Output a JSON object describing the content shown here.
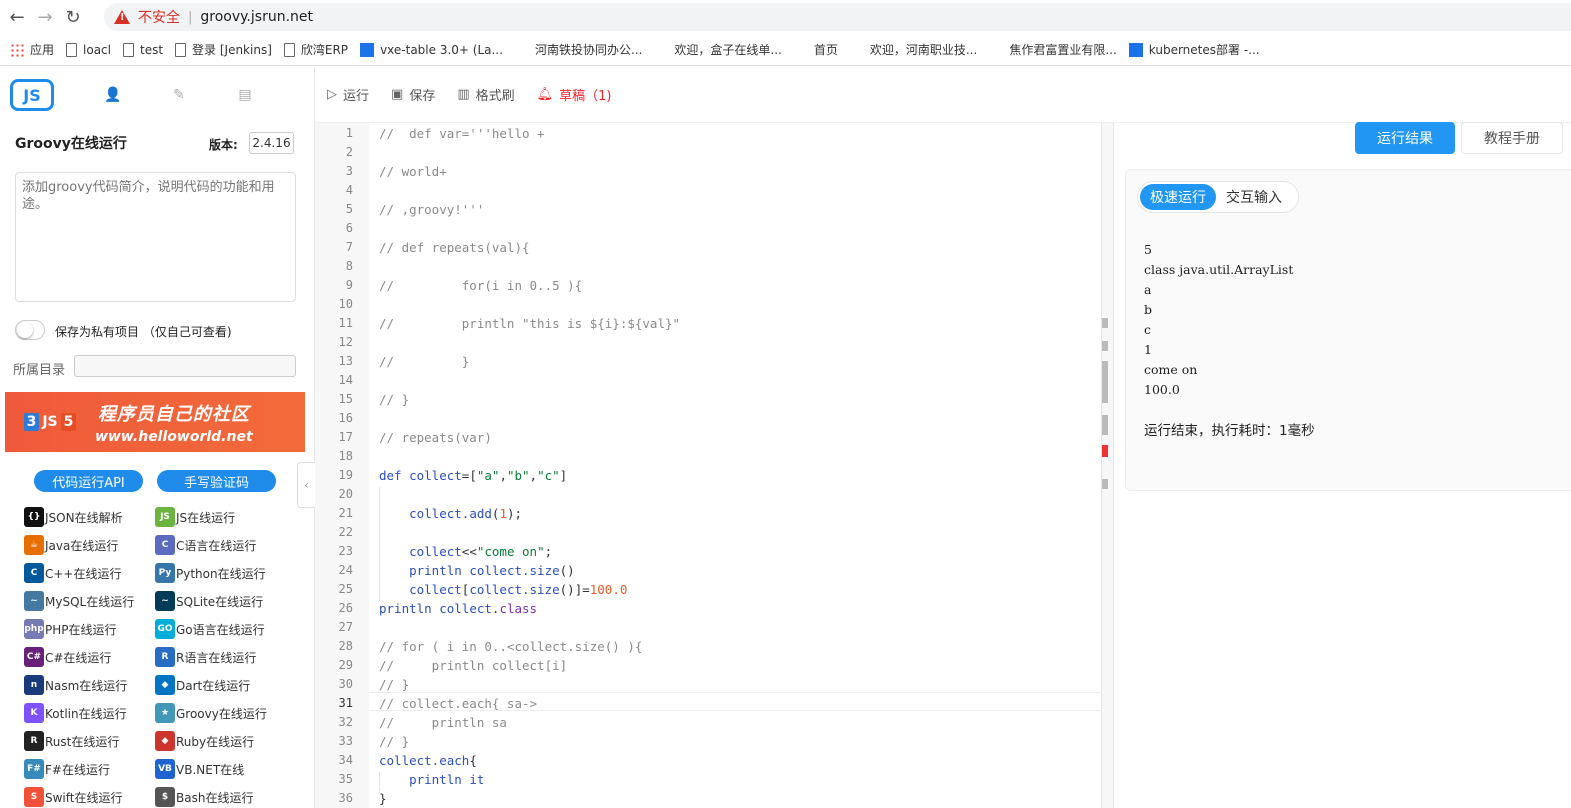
{
  "browser": {
    "insecure_label": "不安全",
    "url": "groovy.jsrun.net",
    "bookmarks": [
      "应用",
      "loacl",
      "test",
      "登录 [Jenkins]",
      "欣湾ERP",
      "vxe-table 3.0+ (La...",
      "河南铁投协同办公...",
      "欢迎，盒子在线单...",
      "首页",
      "欢迎，河南职业技...",
      "焦作君富置业有限...",
      "kubernetes部署 -..."
    ]
  },
  "left": {
    "logo": "JS",
    "project_title": "Groovy在线运行",
    "version_label": "版本:",
    "version_value": "2.4.16",
    "desc_placeholder": "添加groovy代码简介，说明代码的功能和用途。",
    "private_label": "保存为私有项目  （仅自己可查看)",
    "dir_label": "所属目录",
    "banner_title": "程序员自己的社区",
    "banner_url": "www.helloworld.net",
    "api_button": "代码运行API",
    "captcha_button": "手写验证码",
    "languages": [
      {
        "label": "JSON在线解析",
        "icon": "json-icon",
        "color": "#111111",
        "glyph": "{}"
      },
      {
        "label": "JS在线运行",
        "icon": "nodejs-icon",
        "color": "#6cb33f",
        "glyph": "JS"
      },
      {
        "label": "Java在线运行",
        "icon": "java-icon",
        "color": "#e76f00",
        "glyph": "☕"
      },
      {
        "label": "C语言在线运行",
        "icon": "c-icon",
        "color": "#5c6bc0",
        "glyph": "C"
      },
      {
        "label": "C++在线运行",
        "icon": "cpp-icon",
        "color": "#00599c",
        "glyph": "C"
      },
      {
        "label": "Python在线运行",
        "icon": "python-icon",
        "color": "#3776ab",
        "glyph": "Py"
      },
      {
        "label": "MySQL在线运行",
        "icon": "mysql-icon",
        "color": "#4479a1",
        "glyph": "~"
      },
      {
        "label": "SQLite在线运行",
        "icon": "sqlite-icon",
        "color": "#003b57",
        "glyph": "~"
      },
      {
        "label": "PHP在线运行",
        "icon": "php-icon",
        "color": "#777bb4",
        "glyph": "php"
      },
      {
        "label": "Go语言在线运行",
        "icon": "go-icon",
        "color": "#00add8",
        "glyph": "GO"
      },
      {
        "label": "C#在线运行",
        "icon": "csharp-icon",
        "color": "#68217a",
        "glyph": "C#"
      },
      {
        "label": "R语言在线运行",
        "icon": "r-icon",
        "color": "#276dc3",
        "glyph": "R"
      },
      {
        "label": "Nasm在线运行",
        "icon": "nasm-icon",
        "color": "#1a3a7a",
        "glyph": "n"
      },
      {
        "label": "Dart在线运行",
        "icon": "dart-icon",
        "color": "#0175c2",
        "glyph": "◆"
      },
      {
        "label": "Kotlin在线运行",
        "icon": "kotlin-icon",
        "color": "#7f52ff",
        "glyph": "K"
      },
      {
        "label": "Groovy在线运行",
        "icon": "groovy-icon",
        "color": "#4298b8",
        "glyph": "★"
      },
      {
        "label": "Rust在线运行",
        "icon": "rust-icon",
        "color": "#222222",
        "glyph": "R"
      },
      {
        "label": "Ruby在线运行",
        "icon": "ruby-icon",
        "color": "#cc342d",
        "glyph": "◆"
      },
      {
        "label": "F#在线运行",
        "icon": "fsharp-icon",
        "color": "#378bba",
        "glyph": "F#"
      },
      {
        "label": "VB.NET在线",
        "icon": "vbnet-icon",
        "color": "#1e64d0",
        "glyph": "VB"
      },
      {
        "label": "Swift在线运行",
        "icon": "swift-icon",
        "color": "#f05138",
        "glyph": "S"
      },
      {
        "label": "Bash在线运行",
        "icon": "bash-icon",
        "color": "#555555",
        "glyph": "$"
      }
    ]
  },
  "toolbar": {
    "run": "运行",
    "save": "保存",
    "format": "格式刷",
    "draft": "草稿（1)"
  },
  "editor": {
    "active_line": 31,
    "lines": [
      [
        [
          "c-com",
          "//  def var='''hello +"
        ]
      ],
      [],
      [
        [
          "c-com",
          "// world+"
        ]
      ],
      [],
      [
        [
          "c-com",
          "// ,groovy!'''"
        ]
      ],
      [],
      [
        [
          "c-com",
          "// def repeats(val){"
        ]
      ],
      [],
      [
        [
          "c-com",
          "//         for(i in 0..5 ){"
        ]
      ],
      [],
      [
        [
          "c-com",
          "//         println \"this is ${i}:${val}\""
        ]
      ],
      [],
      [
        [
          "c-com",
          "//         }"
        ]
      ],
      [],
      [
        [
          "c-com",
          "// }"
        ]
      ],
      [],
      [
        [
          "c-com",
          "// repeats(var)"
        ]
      ],
      [],
      [
        [
          "c-kw",
          "def "
        ],
        [
          "c-fn",
          "collect"
        ],
        [
          "",
          "=["
        ],
        [
          "c-str",
          "\"a\""
        ],
        [
          "",
          ","
        ],
        [
          "c-str",
          "\"b\""
        ],
        [
          "",
          ","
        ],
        [
          "c-str",
          "\"c\""
        ],
        [
          "",
          "]"
        ]
      ],
      [],
      [
        [
          "",
          "    "
        ],
        [
          "c-fn",
          "collect.add"
        ],
        [
          "",
          "("
        ],
        [
          "c-num",
          "1"
        ],
        [
          "",
          ");"
        ]
      ],
      [],
      [
        [
          "",
          "    "
        ],
        [
          "c-fn",
          "collect"
        ],
        [
          "",
          "<<"
        ],
        [
          "c-str",
          "\"come on\""
        ],
        [
          "",
          ";"
        ]
      ],
      [
        [
          "",
          "    "
        ],
        [
          "c-kw",
          "println "
        ],
        [
          "c-fn",
          "collect.size"
        ],
        [
          "",
          "()"
        ]
      ],
      [
        [
          "",
          "    "
        ],
        [
          "c-fn",
          "collect"
        ],
        [
          "",
          "["
        ],
        [
          "c-fn",
          "collect.size"
        ],
        [
          "",
          "()]="
        ],
        [
          "c-num",
          "100.0"
        ]
      ],
      [
        [
          "c-kw",
          "println "
        ],
        [
          "c-fn",
          "collect"
        ],
        [
          "",
          "."
        ],
        [
          "c-prop",
          "class"
        ]
      ],
      [],
      [
        [
          "c-com",
          "// for ( i in 0..<collect.size() ){"
        ]
      ],
      [
        [
          "c-com",
          "//     println collect[i]"
        ]
      ],
      [
        [
          "c-com",
          "// }"
        ]
      ],
      [
        [
          "c-com",
          "// collect.each{ sa->"
        ]
      ],
      [
        [
          "c-com",
          "//     println sa"
        ]
      ],
      [
        [
          "c-com",
          "// }"
        ]
      ],
      [
        [
          "c-fn",
          "collect.each"
        ],
        [
          "",
          "{"
        ]
      ],
      [
        [
          "",
          "    "
        ],
        [
          "c-kw",
          "println "
        ],
        [
          "c-fn",
          "it"
        ]
      ],
      [
        [
          "",
          "}"
        ]
      ]
    ]
  },
  "result": {
    "tab_result": "运行结果",
    "tab_manual": "教程手册",
    "mode_fast": "极速运行",
    "mode_interactive": "交互输入",
    "output": "5\nclass java.util.ArrayList\na\nb\nc\n1\ncome on\n100.0",
    "done": "运行结束，执行耗时：1毫秒"
  },
  "colors": {
    "accent": "#2196f3",
    "danger": "#f5222d"
  }
}
